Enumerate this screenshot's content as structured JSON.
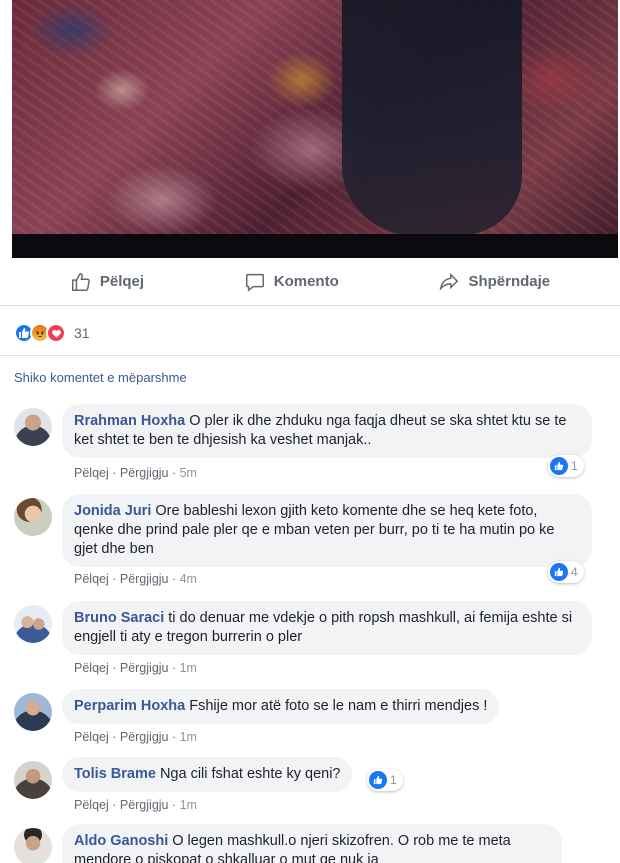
{
  "post": {
    "actions": [
      {
        "label": "Pëlqej",
        "icon": "like-icon"
      },
      {
        "label": "Komento",
        "icon": "comment-icon"
      },
      {
        "label": "Shpërndaje",
        "icon": "share-icon"
      }
    ],
    "reactions": {
      "icons": [
        "like",
        "angry",
        "love"
      ],
      "count": "31"
    },
    "view_previous": "Shiko komentet e mëparshme"
  },
  "comments": [
    {
      "author": "Rrahman Hoxha",
      "text": "O pler ik dhe zhduku nga faqja dheut se ska shtet ktu se te ket shtet te ben te dhjesish ka veshet manjak..",
      "like": "Pëlqej",
      "reply": "Përgjigju",
      "time": "5m",
      "likes": "1"
    },
    {
      "author": "Jonida Juri",
      "text": "Ore bableshi lexon gjith keto komente dhe se heq kete foto, qenke dhe prind pale pler qe e mban veten per burr, po ti te ha mutin po ke gjet dhe ben",
      "like": "Pëlqej",
      "reply": "Përgjigju",
      "time": "4m",
      "likes": "4"
    },
    {
      "author": "Bruno Saraci",
      "text": "ti do denuar me vdekje o pith ropsh mashkull, ai femija eshte si engjell ti aty e tregon burrerin o pler",
      "like": "Pëlqej",
      "reply": "Përgjigju",
      "time": "1m"
    },
    {
      "author": "Perparim Hoxha",
      "text": "Fshije mor atë foto se le nam e thirri mendjes !",
      "like": "Pëlqej",
      "reply": "Përgjigju",
      "time": "1m"
    },
    {
      "author": "Tolis Brame",
      "text": "Nga cili fshat eshte ky qeni?",
      "like": "Pëlqej",
      "reply": "Përgjigju",
      "time": "1m",
      "likes": "1"
    },
    {
      "author": "Aldo Ganoshi",
      "text": "O legen mashkull.o njeri skizofren. O rob me te meta mendore o piskopat o shkalluar o mut qe nuk ja"
    }
  ],
  "colors": {
    "link": "#385898",
    "like_blue": "#1877f2",
    "bubble": "#f2f3f5"
  }
}
